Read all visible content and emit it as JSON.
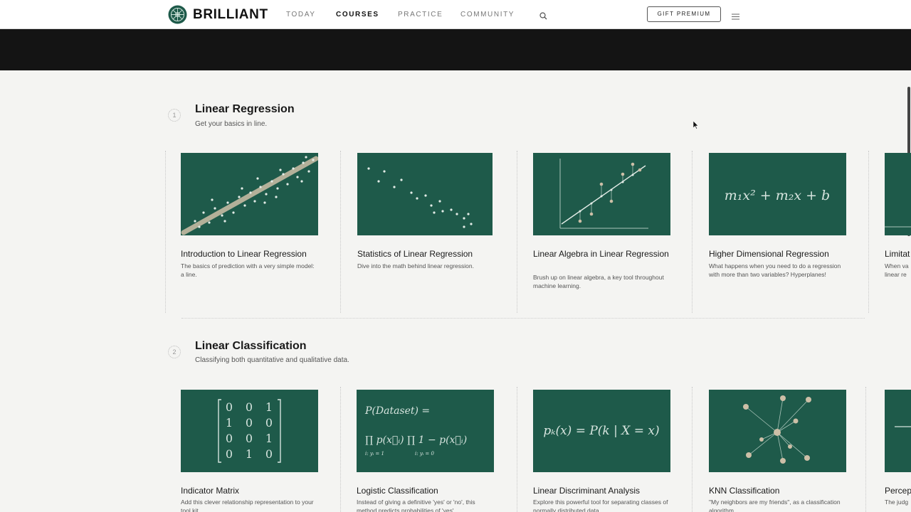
{
  "nav": {
    "brand": "BRILLIANT",
    "links": [
      {
        "label": "TODAY",
        "active": false
      },
      {
        "label": "COURSES",
        "active": true
      },
      {
        "label": "PRACTICE",
        "active": false
      },
      {
        "label": "COMMUNITY",
        "active": false
      }
    ],
    "gift_label": "GIFT PREMIUM"
  },
  "sections": [
    {
      "number": "1",
      "title": "Linear Regression",
      "subtitle": "Get your basics in line.",
      "cards": [
        {
          "title": "Introduction to Linear Regression",
          "desc": "The basics of prediction with a very simple model: a line."
        },
        {
          "title": "Statistics of Linear Regression",
          "desc": "Dive into the math behind linear regression."
        },
        {
          "title": "Linear Algebra in Linear Regression",
          "desc": "Brush up on linear algebra, a key tool throughout machine learning."
        },
        {
          "title": "Higher Dimensional Regression",
          "desc": "What happens when you need to do a regression with more than two variables? Hyperplanes!",
          "formula": "m₁x² + m₂x + b"
        },
        {
          "title": "Limitat",
          "desc": "When va linear re"
        }
      ]
    },
    {
      "number": "2",
      "title": "Linear Classification",
      "subtitle": "Classifying both quantitative and qualitative data.",
      "cards": [
        {
          "title": "Indicator Matrix",
          "desc": "Add this clever relationship representation to your tool kit.",
          "matrix": [
            [
              "0",
              "0",
              "1"
            ],
            [
              "1",
              "0",
              "0"
            ],
            [
              "0",
              "0",
              "1"
            ],
            [
              "0",
              "1",
              "0"
            ]
          ]
        },
        {
          "title": "Logistic Classification",
          "desc": "Instead of giving a definitive 'yes' or 'no', this method predicts probabilities of 'yes'.",
          "formula_top": "P(Dataset) =",
          "formula_bottom": "∏ p(x⃗ᵢ) ∏ 1 − p(x⃗ᵢ)",
          "sub_left": "i: yᵢ = 1",
          "sub_right": "i: yᵢ = 0"
        },
        {
          "title": "Linear Discriminant Analysis",
          "desc": "Explore this powerful tool for separating classes of normally distributed data.",
          "formula": "pₖ(x) = P(k | X = x)"
        },
        {
          "title": "KNN Classification",
          "desc": "\"My neighbors are my friends\", as a classification algorithm."
        },
        {
          "title": "Percep",
          "desc": "The judg"
        }
      ]
    }
  ]
}
